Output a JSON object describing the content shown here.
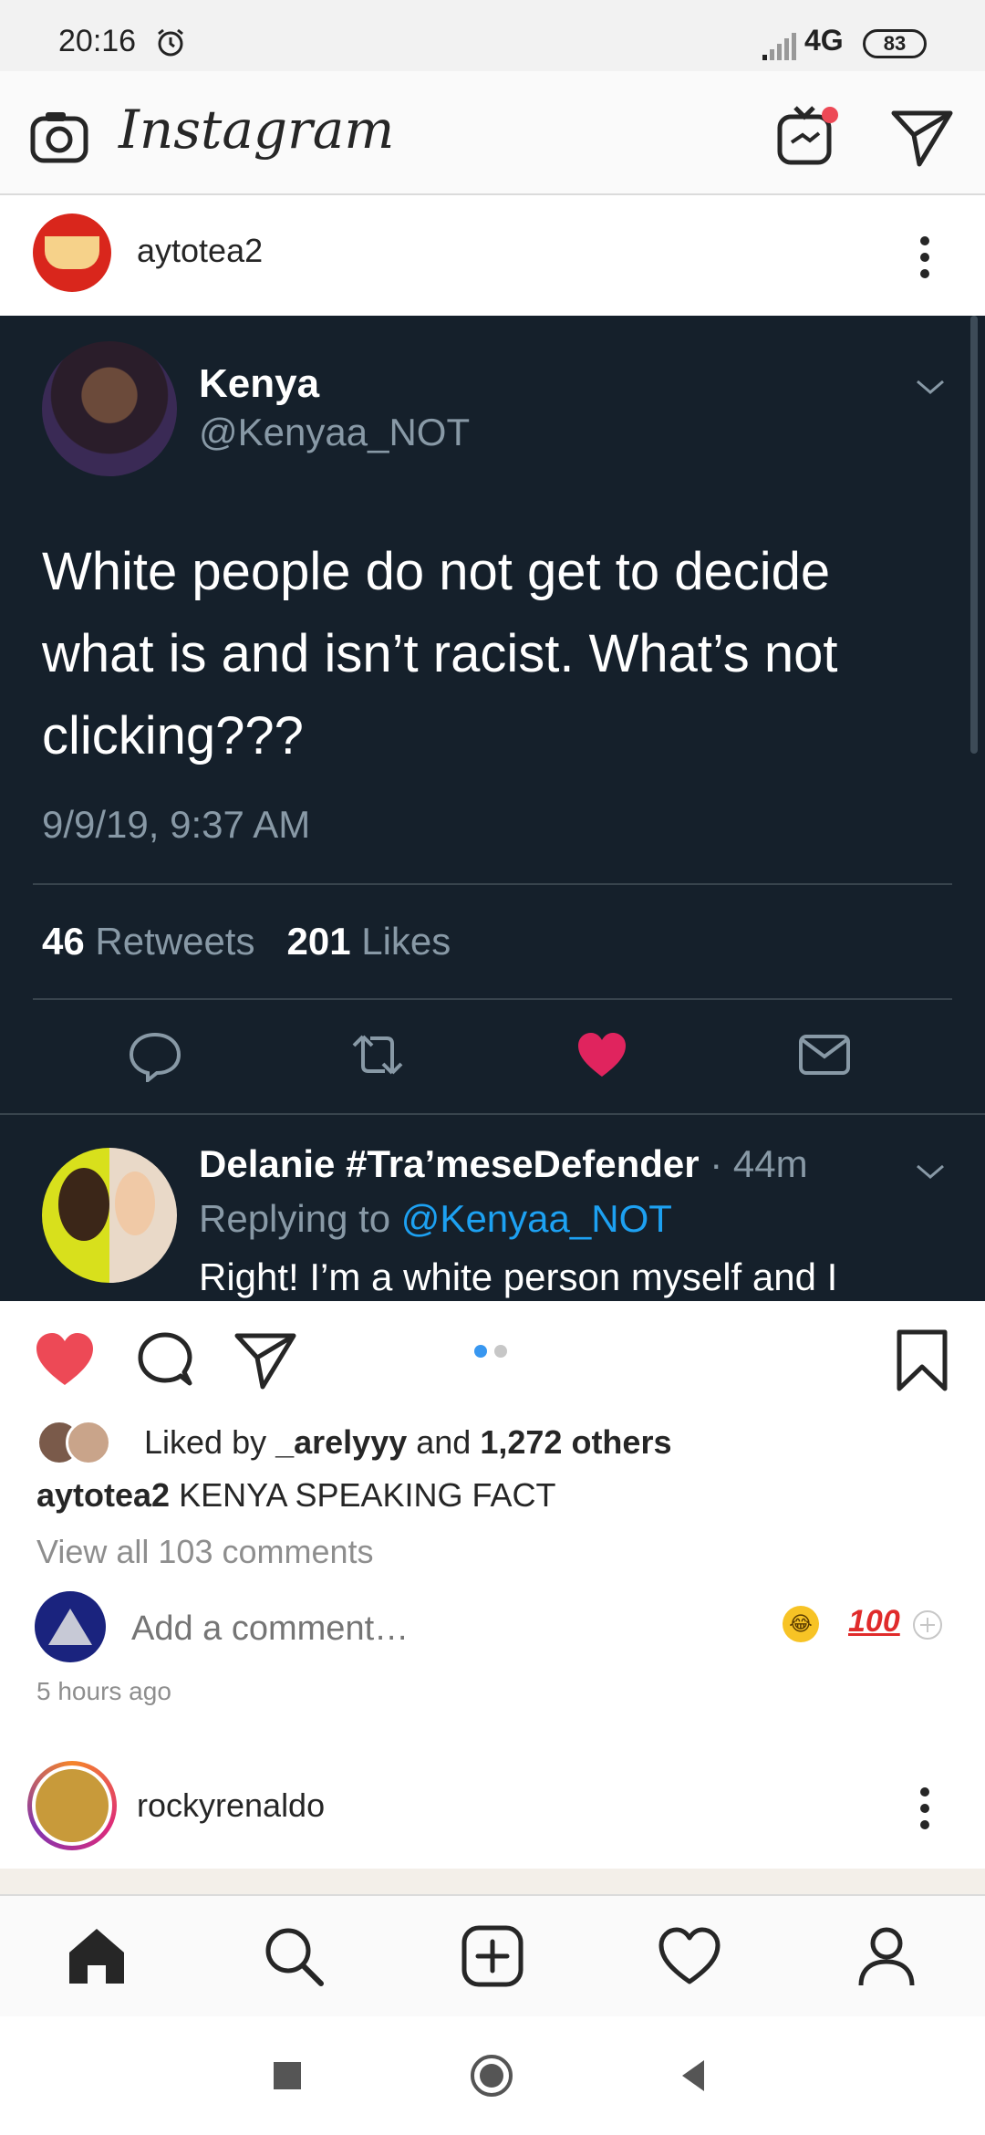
{
  "status_bar": {
    "time": "20:16",
    "network": "4G",
    "battery": "83"
  },
  "header": {
    "brand": "Instagram"
  },
  "post": {
    "username": "aytotea2"
  },
  "tweet": {
    "name": "Kenya",
    "handle": "@Kenyaa_NOT",
    "text": "White people do not get to decide what is and isn’t racist. What’s not clicking???",
    "date": "9/9/19, 9:37 AM",
    "retweets_count": "46",
    "retweets_label": "Retweets",
    "likes_count": "201",
    "likes_label": "Likes",
    "reply": {
      "name": "Delanie #Tra’meseDefender",
      "time": "· 44m",
      "replying_to_prefix": "Replying to",
      "replying_to_handle": "@Kenyaa_NOT",
      "text": "Right! I’m a white person myself and I"
    }
  },
  "engagement": {
    "liked_by_prefix": "Liked by",
    "liked_by_user": "_arelyyy",
    "liked_by_and": "and",
    "liked_by_others": "1,272 others",
    "caption_user": "aytotea2",
    "caption_text": "KENYA SPEAKING FACT",
    "view_comments": "View all 103 comments",
    "comment_placeholder": "Add a comment…",
    "emoji_100": "100",
    "time_ago": "5 hours ago"
  },
  "next_post": {
    "username": "rockyrenaldo"
  },
  "colors": {
    "tweet_bg": "#15202b",
    "like_red": "#ed4956",
    "twitter_heart": "#e0245e",
    "twitter_blue": "#1da1f2",
    "ig_blue": "#3897f0"
  },
  "icons": {
    "header": [
      "camera-icon",
      "igtv-icon",
      "direct-icon"
    ],
    "post_actions": [
      "heart-icon",
      "comment-icon",
      "share-icon",
      "bookmark-icon"
    ],
    "bottom_nav": [
      "home-icon",
      "search-icon",
      "add-post-icon",
      "activity-icon",
      "profile-icon"
    ],
    "android": [
      "recents-button",
      "home-button",
      "back-button"
    ]
  }
}
